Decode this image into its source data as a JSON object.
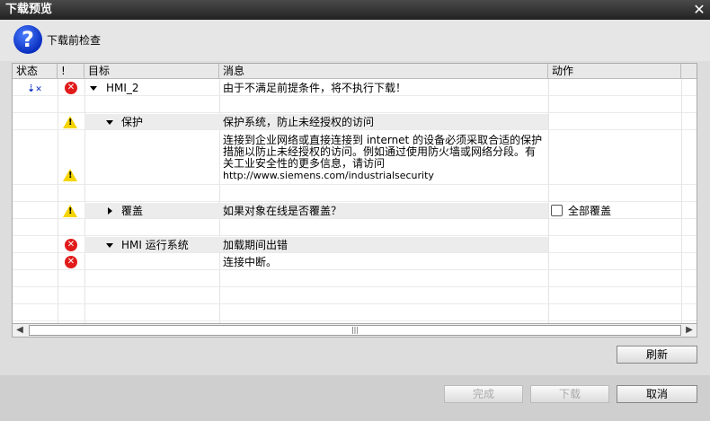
{
  "window": {
    "title": "下载预览"
  },
  "header": {
    "title": "下载前检查"
  },
  "columns": {
    "status": "状态",
    "bang": "!",
    "target": "目标",
    "message": "消息",
    "action": "动作"
  },
  "rows": {
    "hmi": {
      "target": "HMI_2",
      "message": "由于不满足前提条件，将不执行下载！"
    },
    "protect": {
      "target": "保护",
      "message": "保护系统，防止未经授权的访问"
    },
    "note": {
      "message_lines": [
        "连接到企业网络或直接连接到 internet 的设备必须采取合适的保护",
        "措施以防止未经授权的访问。例如通过使用防火墙或网络分段。有",
        "关工业安全性的更多信息，请访问",
        "http://www.siemens.com/industrialsecurity"
      ]
    },
    "overwrite": {
      "target": "覆盖",
      "message": "如果对象在线是否覆盖？",
      "action": "全部覆盖"
    },
    "runtime": {
      "target": "HMI 运行系统",
      "message": "加载期间出错"
    },
    "disconnect": {
      "message": "连接中断。"
    }
  },
  "buttons": {
    "refresh": "刷新",
    "finish": "完成",
    "download": "下载",
    "cancel": "取消"
  },
  "colors": {
    "error": "#e21b1b",
    "warning": "#f5d400",
    "question": "#0a2fbf"
  }
}
